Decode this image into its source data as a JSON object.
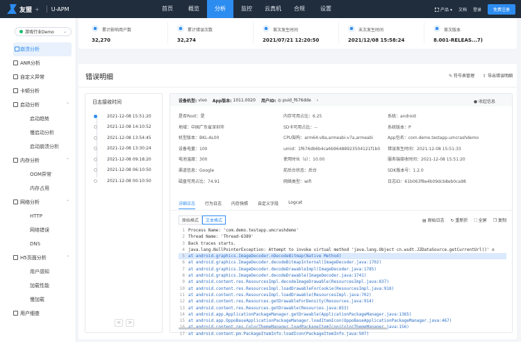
{
  "topnav": {
    "brand": "友盟",
    "brand_plus": "+",
    "product": "U-APM",
    "links": [
      "首页",
      "概览",
      "分析",
      "监控",
      "云真机",
      "合规",
      "设置"
    ],
    "active_index": 2,
    "right": {
      "products": "产品",
      "docs": "文档",
      "login": "登录",
      "trial": "免费注册"
    }
  },
  "sidebar": {
    "app_name": "游戏行业Demo",
    "items": [
      {
        "label": "崩溃分析",
        "level": 1,
        "active": true
      },
      {
        "label": "ANR分析",
        "level": 1
      },
      {
        "label": "自定义异常",
        "level": 1
      },
      {
        "label": "卡顿分析",
        "level": 1
      },
      {
        "label": "启动分析",
        "level": 1,
        "expandable": true
      },
      {
        "label": "启动趋势",
        "level": 2
      },
      {
        "label": "慢启动分析",
        "level": 2
      },
      {
        "label": "启动崩溃分析",
        "level": 2
      },
      {
        "label": "内存分析",
        "level": 1,
        "expandable": true
      },
      {
        "label": "OOM异常",
        "level": 2
      },
      {
        "label": "内存占用",
        "level": 2
      },
      {
        "label": "网络分析",
        "level": 1,
        "expandable": true
      },
      {
        "label": "HTTP",
        "level": 2
      },
      {
        "label": "网络错误",
        "level": 2
      },
      {
        "label": "DNS",
        "level": 2
      },
      {
        "label": "H5页面分析",
        "level": 1,
        "expandable": true
      },
      {
        "label": "用户感知",
        "level": 2
      },
      {
        "label": "加载性能",
        "level": 2
      },
      {
        "label": "慢加载",
        "level": 2
      },
      {
        "label": "用户细查",
        "level": 1
      }
    ]
  },
  "stats": [
    {
      "label": "累计影响用户数",
      "value": "32,270"
    },
    {
      "label": "累计错误次数",
      "value": "32,274"
    },
    {
      "label": "首次发生时间",
      "value": "2021/07/21 12:20:50"
    },
    {
      "label": "末次发生时间",
      "value": "2021/12/08 15:58:24"
    },
    {
      "label": "首次版本",
      "value": "8.001-RELEAS...7)"
    }
  ],
  "panel": {
    "title": "错误明细",
    "actions": [
      "符号表管理",
      "导出错误明细"
    ]
  },
  "timeline": {
    "title": "日志接收时间",
    "items": [
      "2021-12-08 15:51:20",
      "2021-12-08 14:10:52",
      "2021-12-08 13:54:45",
      "2021-12-08 13:30:24",
      "2021-12-08 09:18:20",
      "2021-12-08 06:10:50",
      "2021-12-08 00:10:50"
    ],
    "active_index": 0,
    "prev": "<",
    "next": ">"
  },
  "info": {
    "header": {
      "model_label": "设备机型:",
      "model": "vivo",
      "appver_label": "App版本:",
      "appver": "1011.0020",
      "uid_label": "用户ID:",
      "uid": "puid_f676dde",
      "collapse": "收起信息"
    },
    "col1": [
      "是否Root：是",
      "地域：中国广东省深圳市",
      "机型版本：BKL-AL00",
      "设备电量：100",
      "电池温度：300",
      "渠道信息：Google",
      "磁盘可用占比：74.91"
    ],
    "col2": [
      "内存可用占比：6.25",
      "SD卡可用占比：--",
      "CPU架构：arm64-v8a,armeabi-v7a,armeabi",
      "umid：1f676db6b4ca6b96488923504121f1b0",
      "使用时长（s）：10.00",
      "前后台状态：后台",
      "网络类型：wifi"
    ],
    "col3": [
      "系统：android",
      "系统版本：P",
      "App包名：com.demo.testapp.umcrashdemo",
      "错误发生时间：2021-12-08 15:51:33",
      "服务端接收时间：2021-12-08 15:51:20",
      "SDK版本号：1.2.0",
      "日志ID：61b063f8e4b09dcb8eb0ca98"
    ]
  },
  "tabs": [
    "详细日志",
    "行为日志",
    "内存快照",
    "自定义字段",
    "Logcat"
  ],
  "active_tab": 0,
  "format_buttons": [
    "原始格式",
    "文本格式"
  ],
  "tools": [
    "原始日志",
    "重新折",
    "全屏",
    "复制"
  ],
  "code_lines": [
    {
      "n": "1",
      "t": "Process Name: 'com.demo.testapp.umcrashdemo'"
    },
    {
      "n": "2",
      "t": "Thread Name: 'Thread-6389'"
    },
    {
      "n": "3",
      "t": "Back traces starts."
    },
    {
      "n": "4",
      "t": "java.lang.NullPointerException: Attempt to invoke virtual method 'java.lang.Object cn.wsdt.JZDataSource.getCurrentUrl()' o"
    },
    {
      "n": "5",
      "t": "    at android.graphics.ImageDecoder.nDecodeBitmap(Native Method)",
      "hl": true
    },
    {
      "n": "6",
      "t": "    at android.graphics.ImageDecoder.decodeBitmapInternal(ImageDecoder.java:1702)"
    },
    {
      "n": "7",
      "t": "    at android.graphics.ImageDecoder.decodeDrawableImpl(ImageDecoder.java:1785)"
    },
    {
      "n": "8",
      "t": "    at android.graphics.ImageDecoder.decodeDrawable(ImageDecoder.java:1741)"
    },
    {
      "n": "9",
      "t": "    at android.content.res.ResourcesImpl.decodeImageDrawable(ResourcesImpl.java:837)"
    },
    {
      "n": "10",
      "t": "    at android.content.res.ResourcesImpl.loadDrawableForCookie(ResourcesImpl.java:918)"
    },
    {
      "n": "11",
      "t": "    at android.content.res.ResourcesImpl.loadDrawable(ResourcesImpl.java:702)"
    },
    {
      "n": "12",
      "t": "    at android.content.res.Resources.getDrawableForDensity(Resources.java:914)"
    },
    {
      "n": "13",
      "t": "    at android.content.res.Resources.getDrawable(Resources.java:853)"
    },
    {
      "n": "14",
      "t": "    at android.app.ApplicationPackageManager.getDrawable(ApplicationPackageManager.java:1365)"
    },
    {
      "n": "15",
      "t": "    at android.app.OppoBaseApplicationPackageManager.loadItemIcon(OppoBaseApplicationPackageManager.java:467)"
    },
    {
      "n": "16",
      "t": "    at android.content.res.ColorThemeManager.loadPackageItemIcon(ColorThemeManager.java:156)"
    },
    {
      "n": "17",
      "t": "    at android.content.pm.PackageItemInfo.loadIcon(PackageItemInfo.java:507)"
    }
  ],
  "colors": {
    "accent": "#2d8cf0",
    "nav_bg": "#1f2d3d",
    "highlight": "#dbe9fd"
  }
}
